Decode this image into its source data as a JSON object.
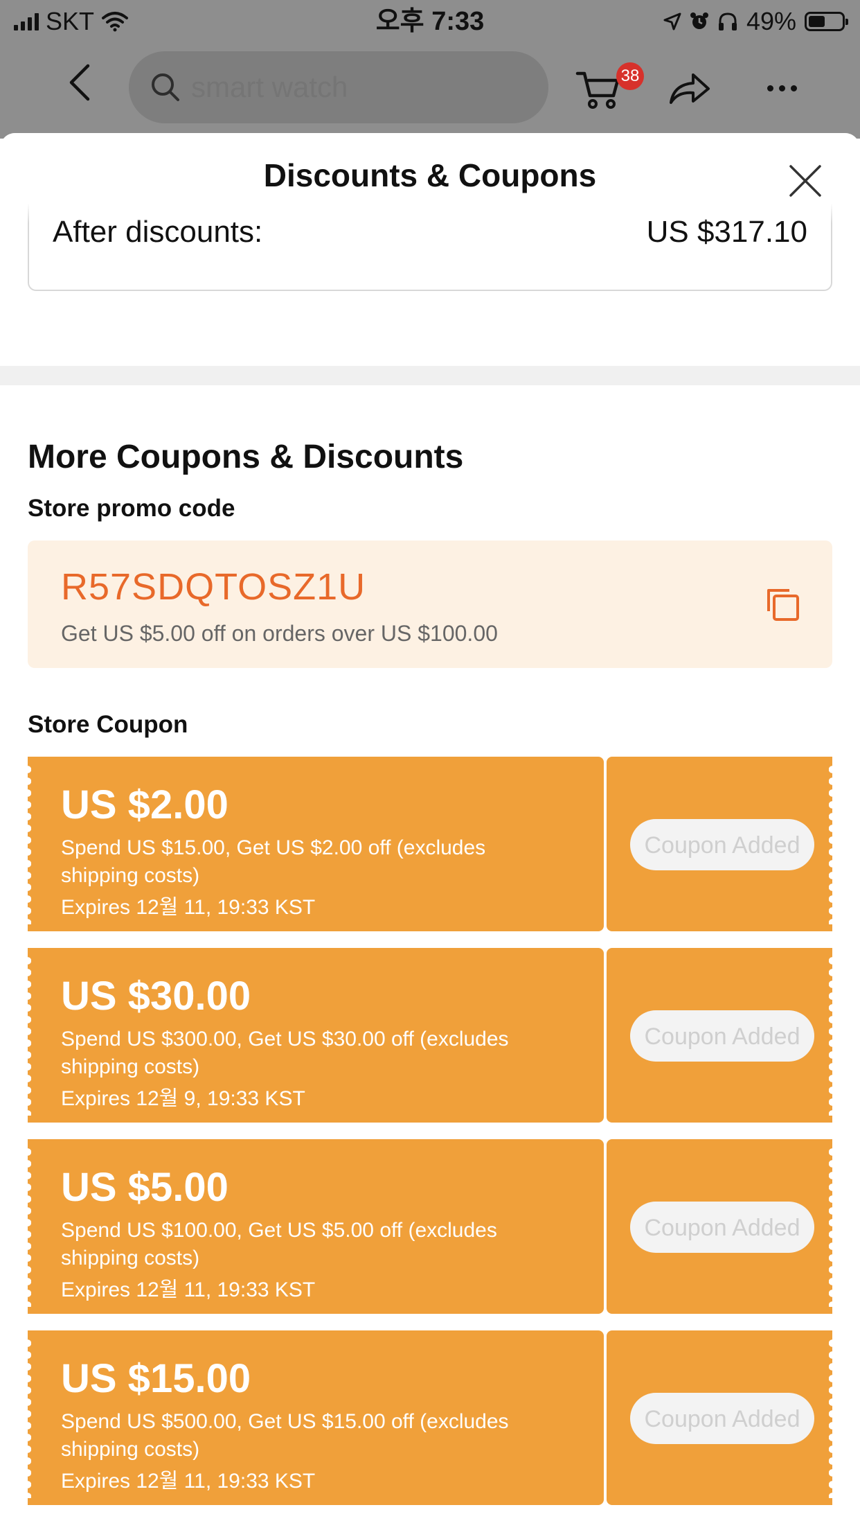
{
  "status_bar": {
    "carrier": "SKT",
    "time": "오후 7:33",
    "battery": "49%",
    "battery_level": 0.49
  },
  "nav": {
    "search_placeholder": "smart watch",
    "cart_count": "38"
  },
  "sheet": {
    "title": "Discounts & Coupons",
    "after_discounts_label": "After discounts:",
    "after_discounts_value": "US $317.10"
  },
  "more": {
    "title": "More Coupons & Discounts",
    "promo_label": "Store promo code",
    "promo_code": "R57SDQTOSZ1U",
    "promo_desc": "Get US $5.00 off on orders over US $100.00",
    "store_coupon_label": "Store Coupon"
  },
  "coupons": [
    {
      "amount": "US $2.00",
      "desc": "Spend US $15.00, Get US $2.00 off (excludes shipping costs)",
      "expires": "Expires 12월 11, 19:33 KST",
      "button": "Coupon Added"
    },
    {
      "amount": "US $30.00",
      "desc": "Spend US $300.00, Get US $30.00 off (excludes shipping costs)",
      "expires": "Expires 12월 9, 19:33 KST",
      "button": "Coupon Added"
    },
    {
      "amount": "US $5.00",
      "desc": "Spend US $100.00, Get US $5.00 off (excludes shipping costs)",
      "expires": "Expires 12월 11, 19:33 KST",
      "button": "Coupon Added"
    },
    {
      "amount": "US $15.00",
      "desc": "Spend US $500.00, Get US $15.00 off (excludes shipping costs)",
      "expires": "Expires 12월 11, 19:33 KST",
      "button": "Coupon Added"
    }
  ],
  "colors": {
    "coupon_orange": "#f0a03a",
    "promo_bg": "#fdf1e3",
    "promo_code": "#e8692a",
    "badge_red": "#d7312b"
  },
  "icons": [
    "signal-icon",
    "wifi-icon",
    "location-icon",
    "alarm-icon",
    "headphones-icon",
    "battery-icon",
    "back-icon",
    "search-icon",
    "cart-icon",
    "share-icon",
    "more-icon",
    "close-icon",
    "copy-icon"
  ]
}
